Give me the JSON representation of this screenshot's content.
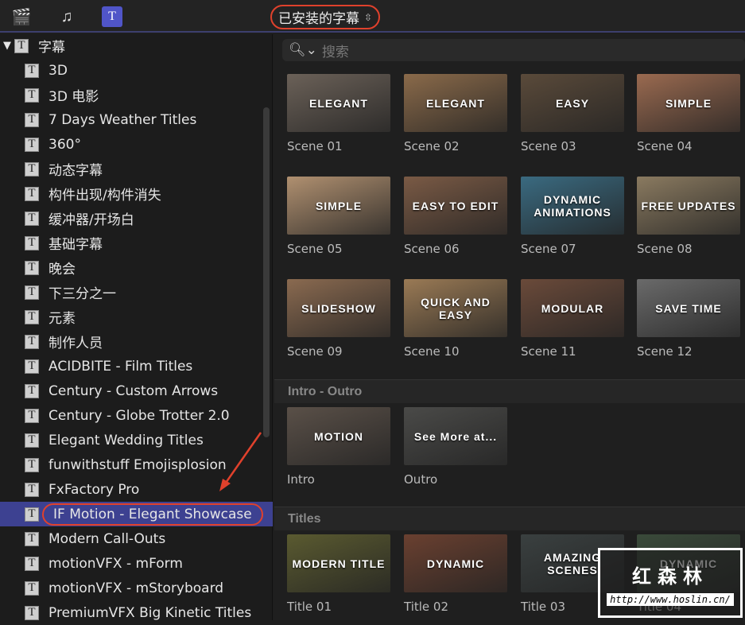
{
  "toolbar": {
    "dropdown": "已安装的字幕",
    "dropdown_chevron": "⌃⌄",
    "icons": [
      "clapper-star-icon",
      "photo-music-icon",
      "titles-icon"
    ]
  },
  "search": {
    "placeholder": "搜索"
  },
  "sidebar": {
    "root": "字幕",
    "items": [
      "3D",
      "3D 电影",
      "7 Days Weather Titles",
      "360°",
      "动态字幕",
      "构件出现/构件消失",
      "缓冲器/开场白",
      "基础字幕",
      "晚会",
      "下三分之一",
      "元素",
      "制作人员",
      "ACIDBITE - Film Titles",
      "Century - Custom Arrows",
      "Century - Globe Trotter 2.0",
      "Elegant Wedding Titles",
      "funwithstuff Emojisplosion",
      "FxFactory Pro",
      "IF Motion - Elegant Showcase",
      "Modern Call-Outs",
      "motionVFX - mForm",
      "motionVFX - mStoryboard",
      "PremiumVFX Big Kinetic Titles"
    ],
    "selected_index": 18
  },
  "scenes": [
    {
      "label": "Scene 01",
      "text": "ELEGANT",
      "c": "#6b6158"
    },
    {
      "label": "Scene 02",
      "text": "ELEGANT",
      "c": "#8a6a4a"
    },
    {
      "label": "Scene 03",
      "text": "EASY",
      "c": "#5a4a3a"
    },
    {
      "label": "Scene 04",
      "text": "SIMPLE",
      "c": "#9a6a50"
    },
    {
      "label": "Scene 05",
      "text": "SIMPLE",
      "c": "#b09070"
    },
    {
      "label": "Scene 06",
      "text": "EASY TO EDIT",
      "c": "#7a5a45"
    },
    {
      "label": "Scene 07",
      "text": "DYNAMIC ANIMATIONS",
      "c": "#3a6a80"
    },
    {
      "label": "Scene 08",
      "text": "FREE UPDATES",
      "c": "#8a7a60"
    },
    {
      "label": "Scene 09",
      "text": "SLIDESHOW",
      "c": "#8a6a50"
    },
    {
      "label": "Scene 10",
      "text": "QUICK AND EASY",
      "c": "#9a7a55"
    },
    {
      "label": "Scene 11",
      "text": "MODULAR",
      "c": "#6a4a3a"
    },
    {
      "label": "Scene 12",
      "text": "SAVE TIME",
      "c": "#6a6a6a"
    }
  ],
  "sections": [
    {
      "title": "Intro - Outro",
      "tiles": [
        {
          "label": "Intro",
          "text": "MOTION",
          "c": "#5a5048"
        },
        {
          "label": "Outro",
          "text": "See More at...",
          "c": "#4a4a48"
        }
      ]
    },
    {
      "title": "Titles",
      "tiles": [
        {
          "label": "Title 01",
          "text": "MODERN TITLE",
          "c": "#5a5a30"
        },
        {
          "label": "Title 02",
          "text": "DYNAMIC",
          "c": "#6a4030"
        },
        {
          "label": "Title 03",
          "text": "AMAZING SCENES",
          "c": "#3a4040"
        },
        {
          "label": "Title 04",
          "text": "DYNAMIC",
          "c": "#3a4a3a"
        }
      ]
    }
  ],
  "watermark": {
    "name": "红森林",
    "url": "http://www.hoslin.cn/"
  }
}
